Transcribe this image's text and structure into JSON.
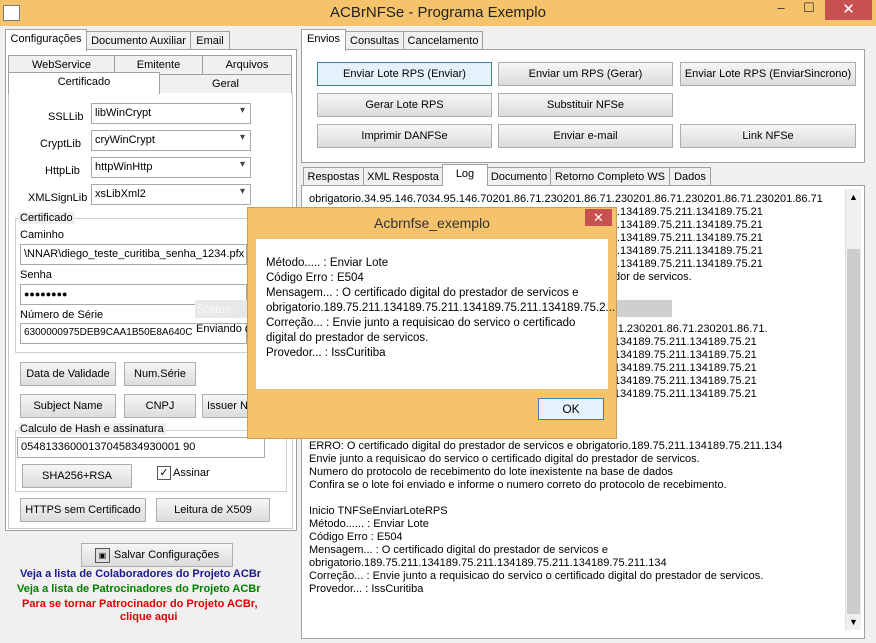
{
  "window": {
    "title": "ACBrNFSe - Programa Exemplo",
    "minimize": "–",
    "maximize": "☐",
    "close": "✕"
  },
  "left_tabs": [
    "Configurações",
    "Documento Auxiliar",
    "Email"
  ],
  "config_tabs_row1": [
    "WebService",
    "Emitente",
    "Arquivos"
  ],
  "config_tabs_row2": [
    "Certificado",
    "Geral"
  ],
  "ssl": {
    "ssllib_label": "SSLLib",
    "ssllib": "libWinCrypt",
    "cryptlib_label": "CryptLib",
    "cryptlib": "cryWinCrypt",
    "httplib_label": "HttpLib",
    "httplib": "httpWinHttp",
    "xmlsign_label": "XMLSignLib",
    "xmlsign": "xsLibXml2"
  },
  "cert": {
    "group": "Certificado",
    "caminho_label": "Caminho",
    "caminho": "\\NNAR\\diego_teste_curitiba_senha_1234.pfx",
    "senha_label": "Senha",
    "senha": "●●●●●●●●",
    "serie_label": "Número de Série",
    "serie": "6300000975DEB9CAA1B50E8A640C"
  },
  "status": {
    "title": "Status do",
    "text": "Enviando d"
  },
  "cert_buttons": {
    "validade": "Data de Validade",
    "num_serie": "Num.Série",
    "subject": "Subject Name",
    "cnpj": "CNPJ",
    "issuer": "Issuer N"
  },
  "hash": {
    "group": "Calculo de Hash e assinatura",
    "value": "05481336000137045834930001 90",
    "sha": "SHA256+RSA",
    "assinar": "Assinar",
    "https": "HTTPS sem Certificado",
    "x509": "Leitura de X509"
  },
  "save_button": "Salvar Configurações",
  "links": {
    "colab": "Veja a lista de Colaboradores do Projeto ACBr",
    "patro": "Veja a lista de Patrocinadores do Projeto ACBr",
    "tornar1": "Para se tornar Patrocinador do Projeto ACBr,",
    "tornar2": "clique aqui",
    "colab_color": "#1a1a8c",
    "patro_color": "#008000",
    "tornar_color": "#e00000"
  },
  "right_tabs": [
    "Envios",
    "Consultas",
    "Cancelamento"
  ],
  "envios_buttons": [
    "Enviar Lote RPS (Enviar)",
    "Enviar um RPS (Gerar)",
    "Enviar Lote RPS (EnviarSincrono)",
    "Gerar Lote RPS",
    "Substituir NFSe",
    "Imprimir DANFSe",
    "Enviar e-mail",
    "Link NFSe"
  ],
  "result_tabs": [
    "Respostas",
    "XML Resposta",
    "Log",
    "Documento",
    "Retorno Completo WS",
    "Dados"
  ],
  "log_lines": [
    "obrigatorio.34.95.146.7034.95.146.70201.86.71.230201.86.71.230201.86.71.230201.86.71.230201.86.71",
    "                                                                             134189.75.211.134189.75.211.134189.75.21",
    "                                                                             134189.75.211.134189.75.211.134189.75.21",
    "                                                                             134189.75.211.134189.75.211.134189.75.21",
    "                                                                             134189.75.211.134189.75.211.134189.75.21",
    "                                                                             134189.75.211.134189.75.211.134189.75.21",
    "                                                                                tal do prestador de servicos.",
    "",
    "",
    "",
    "                                                                           .71.230201.86.71.230201.86.71.230201.86.71.",
    "                                                                           134189.75.211.134189.75.211.134189.75.21",
    "                                                                           134189.75.211.134189.75.211.134189.75.21",
    "                                                                           134189.75.211.134189.75.211.134189.75.21",
    "                                                                           134189.75.211.134189.75.211.134189.75.21",
    "                                                                           134189.75.211.134189.75.211.134189.75.21",
    "",
    "                                                                           or de servicos.",
    "",
    "ERRO: O certificado digital do prestador de servicos e obrigatorio.189.75.211.134189.75.211.134",
    "Envie junto a requisicao do servico o certificado digital do prestador de servicos.",
    "Numero do protocolo de recebimento do lote inexistente na base de dados",
    "Confira se o lote foi enviado e informe o numero correto do protocolo de recebimento.",
    "",
    "Inicio TNFSeEnviarLoteRPS",
    "Método...... : Enviar Lote",
    "Código Erro : E504",
    "Mensagem... : O certificado digital do prestador de servicos e",
    "obrigatorio.189.75.211.134189.75.211.134189.75.211.134189.75.211.134",
    "Correção... : Envie junto a requisicao do servico o certificado digital do prestador de servicos.",
    "Provedor... : IssCuritiba"
  ],
  "dialog": {
    "title": "Acbrnfse_exemplo",
    "close": "✕",
    "lines": [
      "Método..... : Enviar Lote",
      "Código Erro : E504",
      "Mensagem... : O certificado digital do prestador de servicos e",
      "obrigatorio.189.75.211.134189.75.211.134189.75.211.134189.75.2...",
      "Correção... : Envie junto a requisicao do servico o certificado",
      "digital do prestador de servicos.",
      "Provedor... : IssCuritiba"
    ],
    "ok": "OK"
  }
}
